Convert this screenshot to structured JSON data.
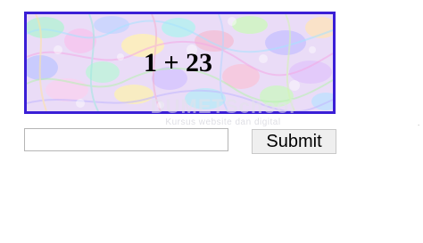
{
  "captcha": {
    "expression": "1 + 23",
    "border_color": "#3a1ed6"
  },
  "watermark": {
    "title": "DUMETSchool",
    "subtitle": "Kursus website dan digital"
  },
  "answer": {
    "value": "",
    "placeholder": ""
  },
  "submit": {
    "label": "Submit"
  },
  "edge_text": "."
}
